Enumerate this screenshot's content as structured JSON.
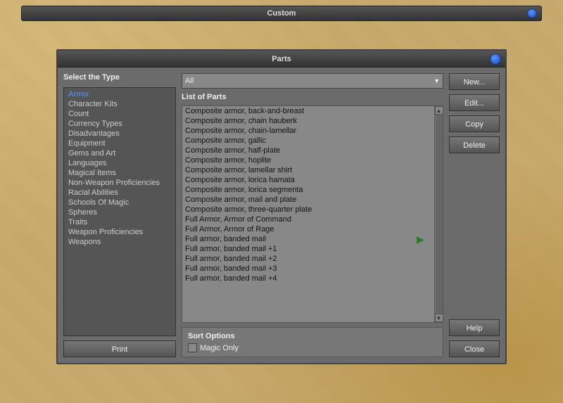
{
  "window": {
    "title": "Custom",
    "close_btn": ""
  },
  "dialog": {
    "title": "Parts",
    "close_btn": ""
  },
  "left_panel": {
    "select_type_label": "Select the Type",
    "items": [
      {
        "label": "Armor",
        "selected": true
      },
      {
        "label": "Character Kits"
      },
      {
        "label": "Count"
      },
      {
        "label": "Currency Types"
      },
      {
        "label": "Disadvantages"
      },
      {
        "label": "Equipment"
      },
      {
        "label": "Gems and Art"
      },
      {
        "label": "Languages"
      },
      {
        "label": "Magical Items"
      },
      {
        "label": "Non-Weapon Proficiencies"
      },
      {
        "label": "Racial Abilities"
      },
      {
        "label": "Schools Of Magic"
      },
      {
        "label": "Spheres"
      },
      {
        "label": "Traits"
      },
      {
        "label": "Weapon Proficiencies"
      },
      {
        "label": "Weapons"
      }
    ],
    "print_label": "Print"
  },
  "middle_panel": {
    "dropdown_label": "All",
    "parts_list_label": "List of Parts",
    "items": [
      "Composite armor, back-and-breast",
      "Composite armor, chain hauberk",
      "Composite armor, chain-lamellar",
      "Composite armor, gallic",
      "Composite armor, half-plate",
      "Composite armor, hoplite",
      "Composite armor, lamellar shirt",
      "Composite armor, lorica hamata",
      "Composite armor, lorica segmenta",
      "Composite armor, mail and plate",
      "Composite armor, three-quarter plate",
      "Full Armor, Armor of Command",
      "Full Armor, Armor of Rage",
      "Full armor, banded mail",
      "Full armor, banded mail +1",
      "Full armor, banded mail +2",
      "Full armor, banded mail +3",
      "Full armor, banded mail +4"
    ],
    "sort_options": {
      "label": "Sort Options",
      "magic_only_label": "Magic Only",
      "magic_only_checked": false
    }
  },
  "right_panel": {
    "new_label": "New...",
    "edit_label": "Edit...",
    "copy_label": "Copy",
    "delete_label": "Delete",
    "help_label": "Help",
    "close_label": "Close"
  }
}
